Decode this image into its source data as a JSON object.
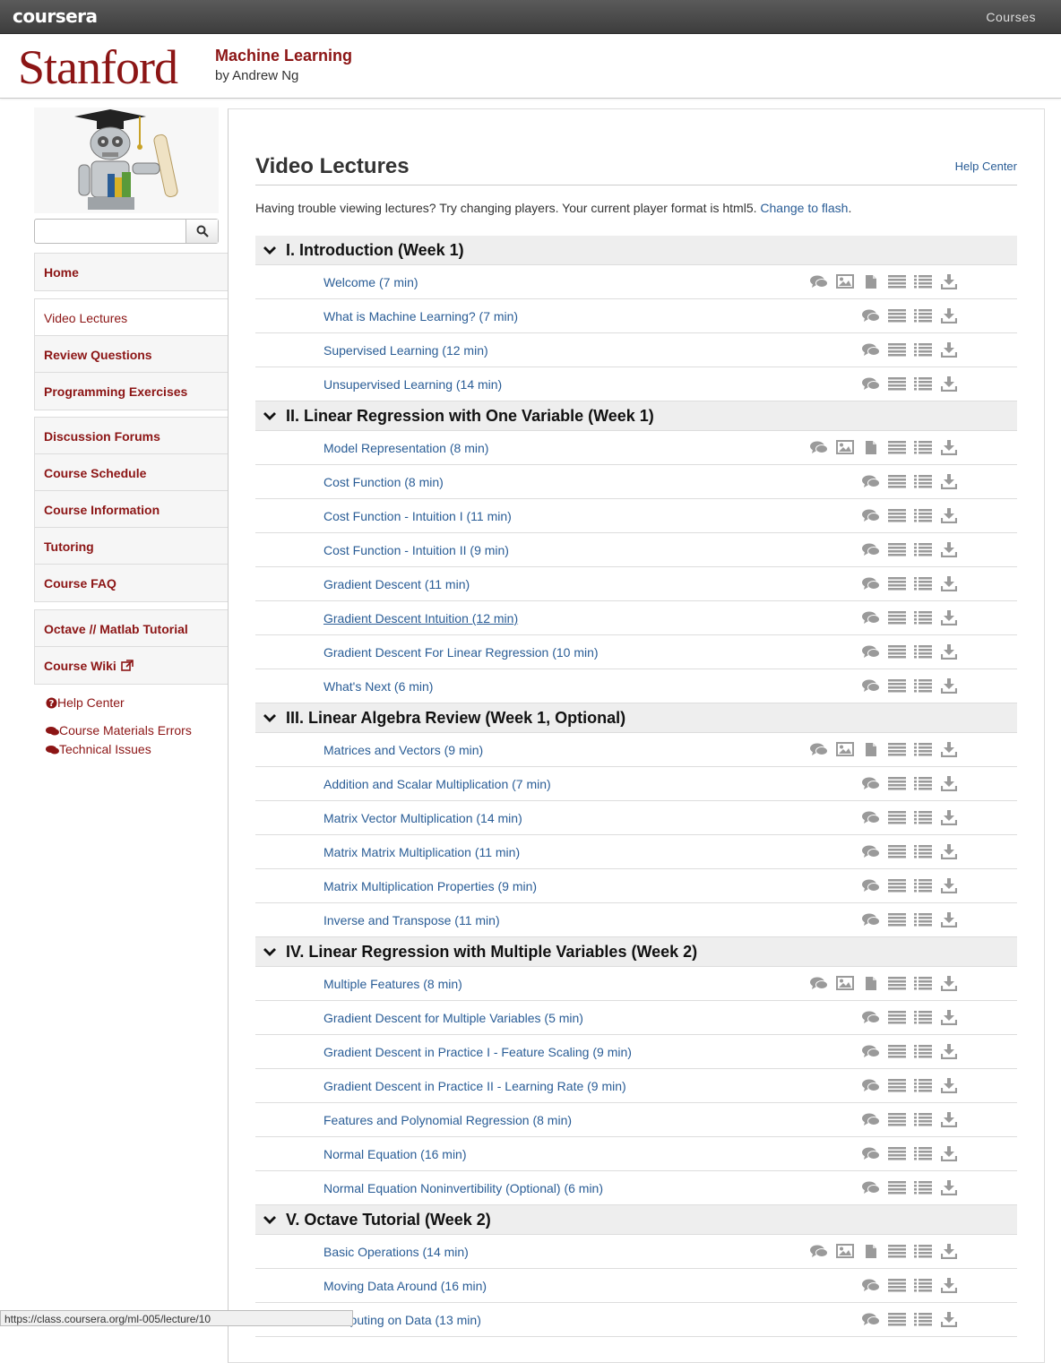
{
  "topbar": {
    "logo": "coursera",
    "courses_label": "Courses"
  },
  "header": {
    "university": "Stanford",
    "course_title": "Machine Learning",
    "instructor": "by Andrew Ng"
  },
  "sidebar": {
    "search_placeholder": "",
    "groups": [
      {
        "items": [
          {
            "label": "Home",
            "active": false
          }
        ]
      },
      {
        "items": [
          {
            "label": "Video Lectures",
            "active": true
          },
          {
            "label": "Review Questions",
            "active": false
          },
          {
            "label": "Programming Exercises",
            "active": false
          }
        ]
      },
      {
        "items": [
          {
            "label": "Discussion Forums",
            "active": false
          },
          {
            "label": "Course Schedule",
            "active": false
          },
          {
            "label": "Course Information",
            "active": false
          },
          {
            "label": "Tutoring",
            "active": false
          },
          {
            "label": "Course FAQ",
            "active": false
          }
        ]
      },
      {
        "items": [
          {
            "label": "Octave // Matlab Tutorial",
            "active": false
          },
          {
            "label": "Course Wiki",
            "active": false
          }
        ]
      }
    ],
    "help_center": "Help Center",
    "course_materials_errors": "Course Materials Errors",
    "technical_issues": "Technical Issues"
  },
  "main": {
    "title": "Video Lectures",
    "help_center": "Help Center",
    "notice_text": "Having trouble viewing lectures? Try changing players. Your current player format is html5. ",
    "notice_link": "Change to flash",
    "notice_end": ".",
    "sections": [
      {
        "title": "I. Introduction (Week 1)",
        "lectures": [
          {
            "title": "Welcome (7 min)",
            "full_icons": true
          },
          {
            "title": "What is Machine Learning? (7 min)",
            "full_icons": false
          },
          {
            "title": "Supervised Learning (12 min)",
            "full_icons": false
          },
          {
            "title": "Unsupervised Learning (14 min)",
            "full_icons": false
          }
        ]
      },
      {
        "title": "II. Linear Regression with One Variable (Week 1)",
        "lectures": [
          {
            "title": "Model Representation (8 min)",
            "full_icons": true
          },
          {
            "title": "Cost Function (8 min)",
            "full_icons": false
          },
          {
            "title": "Cost Function - Intuition I (11 min)",
            "full_icons": false
          },
          {
            "title": "Cost Function - Intuition II (9 min)",
            "full_icons": false
          },
          {
            "title": "Gradient Descent (11 min)",
            "full_icons": false
          },
          {
            "title": "Gradient Descent Intuition (12 min)",
            "full_icons": false,
            "visited": true
          },
          {
            "title": "Gradient Descent For Linear Regression (10 min)",
            "full_icons": false
          },
          {
            "title": "What's Next (6 min)",
            "full_icons": false
          }
        ]
      },
      {
        "title": "III. Linear Algebra Review (Week 1, Optional)",
        "lectures": [
          {
            "title": "Matrices and Vectors (9 min)",
            "full_icons": true
          },
          {
            "title": "Addition and Scalar Multiplication (7 min)",
            "full_icons": false
          },
          {
            "title": "Matrix Vector Multiplication (14 min)",
            "full_icons": false
          },
          {
            "title": "Matrix Matrix Multiplication (11 min)",
            "full_icons": false
          },
          {
            "title": "Matrix Multiplication Properties (9 min)",
            "full_icons": false
          },
          {
            "title": "Inverse and Transpose (11 min)",
            "full_icons": false
          }
        ]
      },
      {
        "title": "IV. Linear Regression with Multiple Variables (Week 2)",
        "lectures": [
          {
            "title": "Multiple Features (8 min)",
            "full_icons": true
          },
          {
            "title": "Gradient Descent for Multiple Variables (5 min)",
            "full_icons": false
          },
          {
            "title": "Gradient Descent in Practice I - Feature Scaling (9 min)",
            "full_icons": false
          },
          {
            "title": "Gradient Descent in Practice II - Learning Rate (9 min)",
            "full_icons": false
          },
          {
            "title": "Features and Polynomial Regression (8 min)",
            "full_icons": false
          },
          {
            "title": "Normal Equation (16 min)",
            "full_icons": false
          },
          {
            "title": "Normal Equation Noninvertibility (Optional) (6 min)",
            "full_icons": false
          }
        ]
      },
      {
        "title": "V. Octave Tutorial (Week 2)",
        "lectures": [
          {
            "title": "Basic Operations (14 min)",
            "full_icons": true
          },
          {
            "title": "Moving Data Around (16 min)",
            "full_icons": false
          },
          {
            "title": "Computing on Data (13 min)",
            "full_icons": false
          }
        ]
      }
    ]
  },
  "statusbar": {
    "url": "https://class.coursera.org/ml-005/lecture/10"
  },
  "colors": {
    "brand_red": "#8c1515",
    "link_blue": "#2a5d96",
    "icon_gray": "#9a9a9a"
  }
}
